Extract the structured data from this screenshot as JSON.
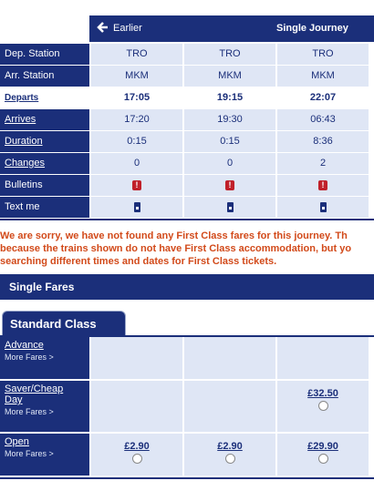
{
  "header": {
    "earlier_label": "Earlier",
    "journey_type": "Single Journey"
  },
  "rows": {
    "dep_station": {
      "label": "Dep. Station",
      "values": [
        "TRO",
        "TRO",
        "TRO"
      ]
    },
    "arr_station": {
      "label": "Arr. Station",
      "values": [
        "MKM",
        "MKM",
        "MKM"
      ]
    },
    "departs": {
      "label": "Departs",
      "values": [
        "17:05",
        "19:15",
        "22:07"
      ]
    },
    "arrives": {
      "label": "Arrives",
      "values": [
        "17:20",
        "19:30",
        "06:43"
      ]
    },
    "duration": {
      "label": "Duration",
      "values": [
        "0:15",
        "0:15",
        "8:36"
      ]
    },
    "changes": {
      "label": "Changes",
      "values": [
        "0",
        "0",
        "2"
      ]
    },
    "bulletins": {
      "label": "Bulletins",
      "icon": "alert-icon"
    },
    "text_me": {
      "label": "Text me",
      "icon": "mobile-phone-icon"
    }
  },
  "warning": {
    "line1": "We are sorry, we have not found any First Class fares for this journey. Th",
    "line2": "because the trains shown do not have First Class accommodation, but yo",
    "line3": "searching different times and dates for First Class tickets."
  },
  "single_fares": {
    "title": "Single Fares"
  },
  "tab": {
    "label": "Standard Class"
  },
  "fares": [
    {
      "name": "Advance",
      "more": "More Fares >",
      "prices": [
        "",
        "",
        ""
      ]
    },
    {
      "name_line1": "Saver/Cheap",
      "name_line2": "Day",
      "more": "More Fares >",
      "prices": [
        "",
        "",
        "£32.50"
      ]
    },
    {
      "name": "Open",
      "more": "More Fares >",
      "prices": [
        "£2.90",
        "£2.90",
        "£29.90"
      ]
    }
  ],
  "colors": {
    "navy": "#1b2f7a",
    "light": "#dfe6f5",
    "warning": "#d24a1a"
  }
}
